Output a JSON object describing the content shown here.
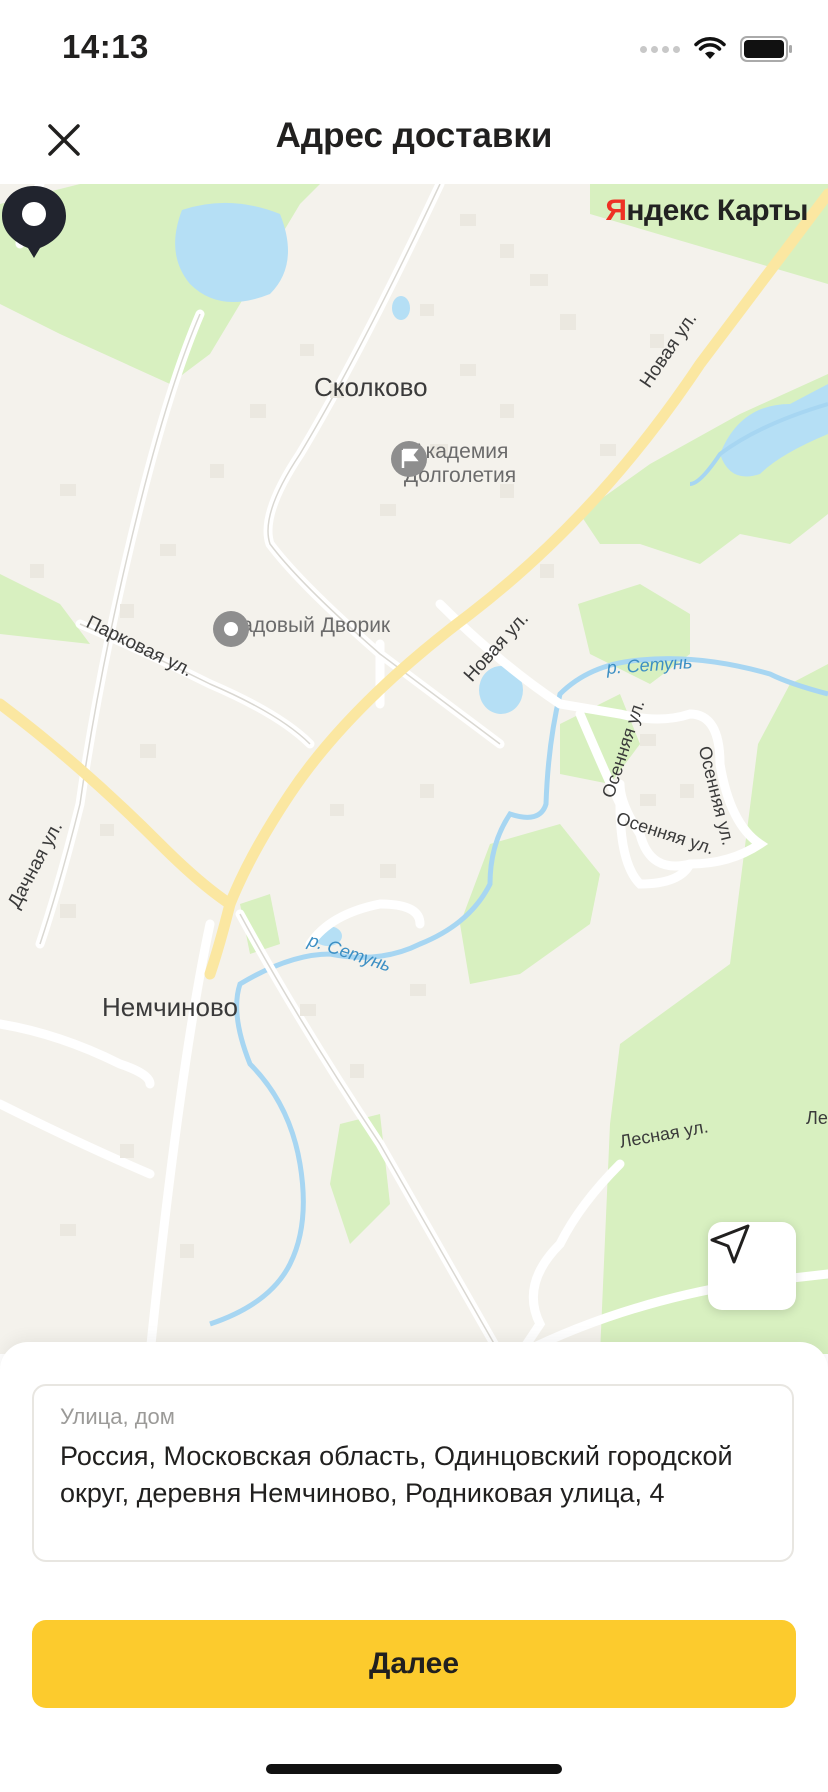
{
  "status_bar": {
    "time": "14:13"
  },
  "header": {
    "title": "Адрес доставки"
  },
  "map": {
    "logo_first": "Я",
    "logo_rest": "ндекс Карты",
    "places": {
      "skolkovo": "Сколково",
      "academy_line1": "Академия",
      "academy_line2": "Долголетия",
      "sadovy": "Садовый Дворик",
      "nemchinovo": "Немчиново"
    },
    "streets": {
      "novaya_1": "Новая ул.",
      "novaya_2": "Новая ул.",
      "parkovaya": "Парковая ул.",
      "dachnaya": "Дачная ул.",
      "osennyaya_1": "Осенняя ул.",
      "osennyaya_2": "Осенняя ул.",
      "osennyaya_3": "Осенняя ул.",
      "lesnaya": "Лесная ул.",
      "lesnaya_cut": "Ле"
    },
    "rivers": {
      "setun_1": "р. Сетунь",
      "setun_2": "р. Сетунь"
    }
  },
  "address": {
    "label": "Улица, дом",
    "value": "Россия, Московская область, Одинцовский городской округ, деревня Немчиново, Родниковая улица, 4"
  },
  "next_button": {
    "label": "Далее"
  },
  "colors": {
    "accent": "#fccb2d",
    "map_background": "#f4f2ec",
    "park": "#d8f0c0",
    "water": "#b5dff5",
    "main_road": "#fbe7a1",
    "pin": "#21242e"
  }
}
